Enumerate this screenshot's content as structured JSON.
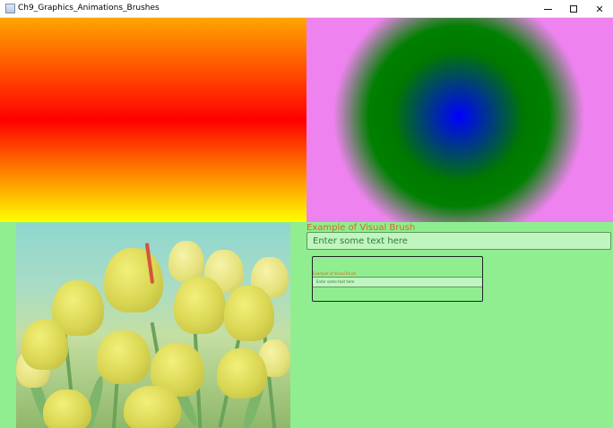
{
  "window": {
    "title": "Ch9_Graphics_Animations_Brushes",
    "minimize_glyph": "–",
    "maximize_glyph": "□",
    "close_glyph": "✕"
  },
  "colors": {
    "client_background": "#90ee90",
    "linear_gradient": [
      "#ffa500",
      "#ff0000",
      "#ffff00"
    ],
    "radial_center": "#0000ff",
    "radial_mid": "#008000",
    "radial_outer": "#ee82ee",
    "header_text": "#d2691e",
    "input_background": "#c0f5c0",
    "input_text": "#2e7d32"
  },
  "image": {
    "subject": "yellow tulips"
  },
  "visual_brush": {
    "header": "Example of Visual Brush",
    "input_value": "Enter some text here",
    "preview_header": "Example of Visual Brush",
    "preview_input_value": "Enter some text here"
  }
}
